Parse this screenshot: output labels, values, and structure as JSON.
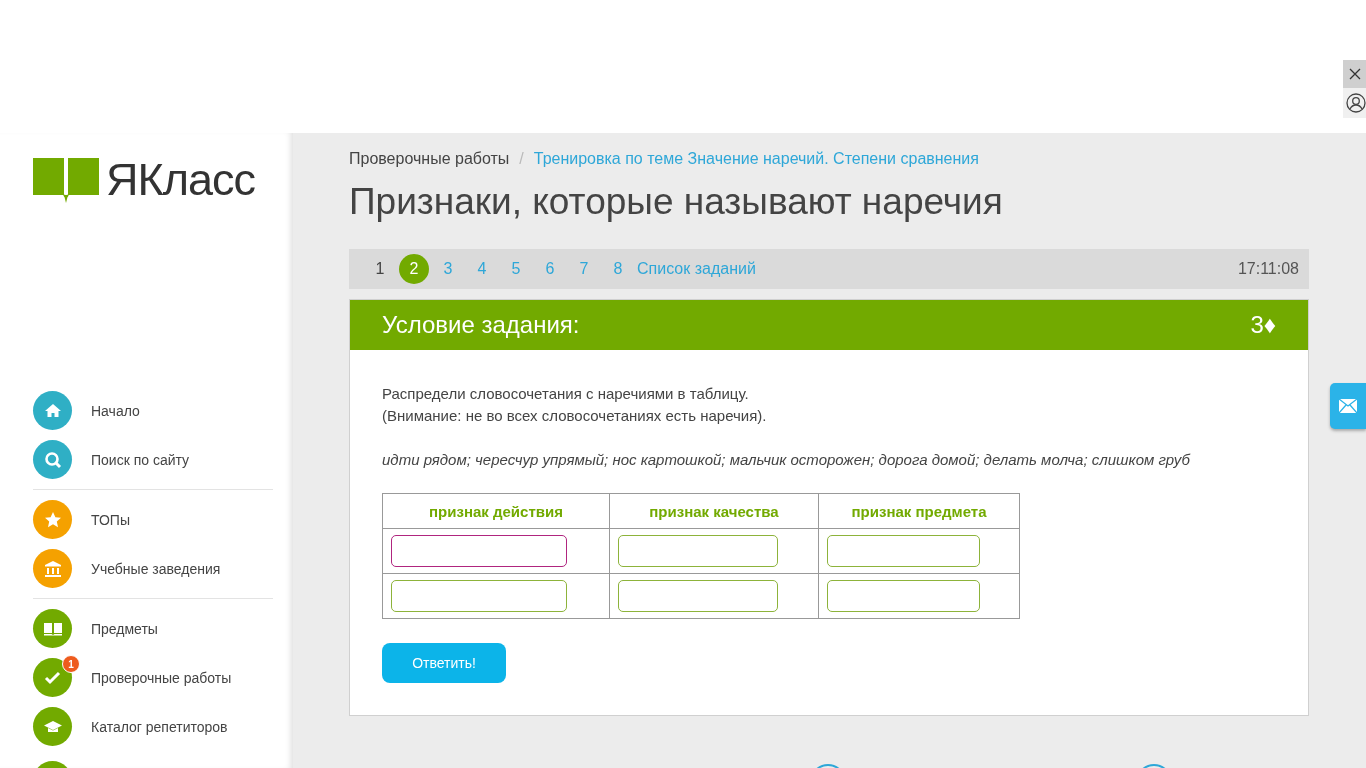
{
  "logo": {
    "text": "ЯКласс"
  },
  "sidebar": {
    "groups": [
      [
        {
          "label": "Начало",
          "color": "#2fafc5"
        },
        {
          "label": "Поиск по сайту",
          "color": "#2fafc5"
        }
      ],
      [
        {
          "label": "ТОПы",
          "color": "#f5a100"
        },
        {
          "label": "Учебные заведения",
          "color": "#f5a100"
        }
      ],
      [
        {
          "label": "Предметы",
          "color": "#72aa00"
        },
        {
          "label": "Проверочные работы",
          "color": "#72aa00",
          "badge": "1"
        },
        {
          "label": "Каталог репетиторов",
          "color": "#72aa00"
        }
      ]
    ]
  },
  "breadcrumb": {
    "separator": "/",
    "items": [
      {
        "label": "Проверочные работы",
        "kind": "text"
      },
      {
        "label": "Тренировка по теме Значение наречий. Степени сравнения",
        "kind": "link"
      }
    ]
  },
  "title": "Признаки, которые называют наречия",
  "task_nav": {
    "items": [
      {
        "label": "1",
        "selected": false,
        "kind": "done"
      },
      {
        "label": "2",
        "selected": true,
        "kind": "link"
      },
      {
        "label": "3",
        "selected": false,
        "kind": "link"
      },
      {
        "label": "4",
        "selected": false,
        "kind": "link"
      },
      {
        "label": "5",
        "selected": false,
        "kind": "link"
      },
      {
        "label": "6",
        "selected": false,
        "kind": "link"
      },
      {
        "label": "7",
        "selected": false,
        "kind": "link"
      },
      {
        "label": "8",
        "selected": false,
        "kind": "link"
      },
      {
        "label": "Список заданий",
        "selected": false,
        "kind": "link"
      }
    ],
    "timer": "17:11:08"
  },
  "task": {
    "header": "Условие задания:",
    "points": "3♦",
    "instructions": [
      "Распредели словосочетания с наречиями в таблицу.",
      "(Внимание: не во всех словосочетаниях есть наречия)."
    ],
    "phrases": "идти рядом; чересчур упрямый; нос картошкой; мальчик осторожен; дорога домой; делать молча; слишком груб",
    "table": {
      "columns": [
        "признак действия",
        "признак качества",
        "признак предмета"
      ],
      "rows": [
        [
          {
            "focused": true
          },
          {
            "focused": false
          },
          {
            "focused": false
          }
        ],
        [
          {
            "focused": false
          },
          {
            "focused": false
          },
          {
            "focused": false
          }
        ]
      ]
    },
    "submit": "Ответить!"
  }
}
